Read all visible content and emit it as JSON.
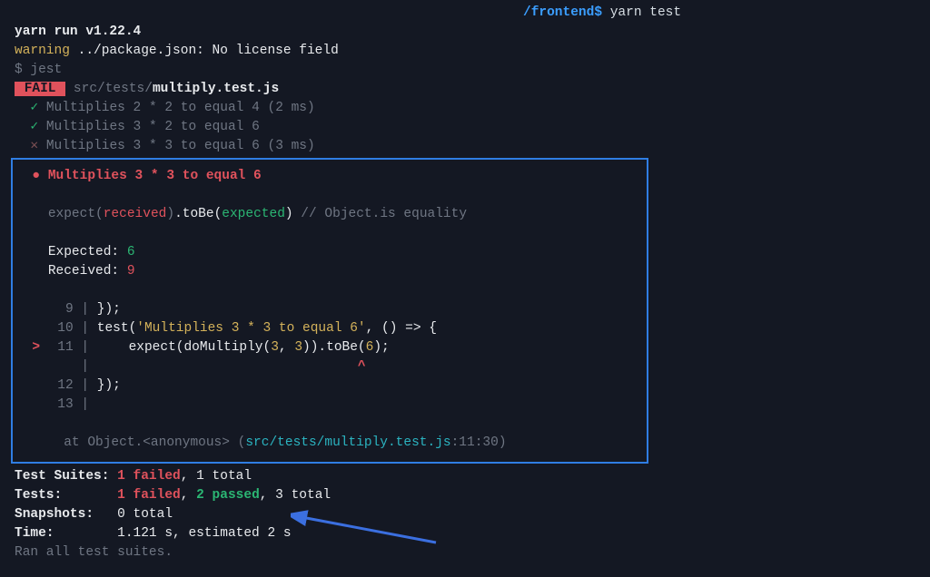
{
  "prompt": {
    "path": "/frontend",
    "symbol": "$",
    "command": "yarn test"
  },
  "intro": {
    "yarn_run": "yarn run v1.22.4",
    "warning_label": "warning",
    "warning_text": " ../package.json: No license field",
    "dollar": "$ ",
    "jest": "jest"
  },
  "suite": {
    "fail_label": " FAIL ",
    "path_prefix": " src/tests/",
    "file": "multiply.test.js"
  },
  "tests": [
    {
      "mark": "✓",
      "name": "Multiplies 2 * 2 to equal 4",
      "time": " (2 ms)"
    },
    {
      "mark": "✓",
      "name": "Multiplies 3 * 2 to equal 6",
      "time": ""
    },
    {
      "mark": "✕",
      "name": "Multiplies 3 * 3 to equal 6",
      "time": " (3 ms)"
    }
  ],
  "detail": {
    "bullet": "●",
    "title": "Multiplies 3 * 3 to equal 6",
    "expect": "expect(",
    "received": "received",
    "closeParen": ")",
    "dot_toBe": ".toBe(",
    "expected": "expected",
    "comment": " // Object.is equality",
    "expected_label": "Expected: ",
    "expected_val": "6",
    "received_label": "Received: ",
    "received_val": "9",
    "code": {
      "l9": "});",
      "l10a": "test(",
      "l10b": "'Multiplies 3 * 3 to equal 6'",
      "l10c": ", () => {",
      "l11a": "    expect(doMultiply(",
      "l11b": "3",
      "l11c": ", ",
      "l11d": "3",
      "l11e": ")).toBe(",
      "l11f": "6",
      "l11g": ");",
      "l12": "});",
      "caret_pad": "                                 ",
      "caret": "^"
    },
    "stack_prefix": "at Object.<anonymous> (",
    "stack_file": "src/tests/multiply.test.js",
    "stack_loc": ":11:30)",
    "ln9": "9",
    "ln10": "10",
    "ln11": "11",
    "ln12": "12",
    "ln13": "13"
  },
  "summary": {
    "suites_label": "Test Suites: ",
    "suites_fail": "1 failed",
    "suites_rest": ", 1 total",
    "tests_label": "Tests:       ",
    "tests_fail": "1 failed",
    "tests_mid": ", ",
    "tests_pass": "2 passed",
    "tests_rest": ", 3 total",
    "snap_label": "Snapshots:   ",
    "snap_val": "0 total",
    "time_label": "Time:        ",
    "time_val": "1.121 s, estimated 2 s",
    "ran": "Ran all test suites."
  }
}
